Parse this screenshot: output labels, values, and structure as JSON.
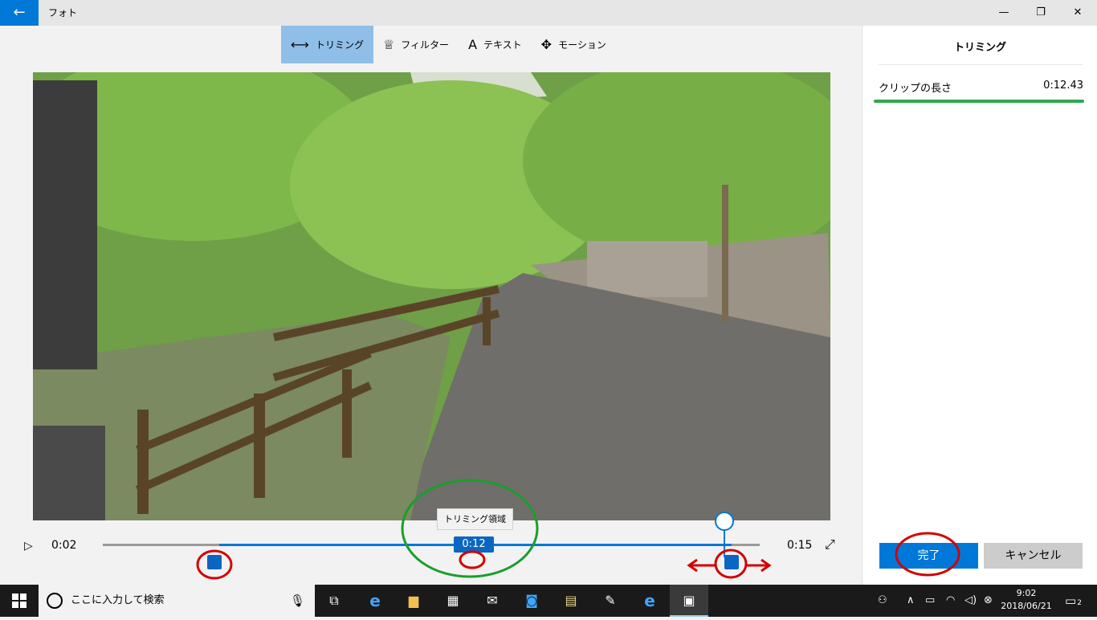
{
  "titlebar": {
    "back_icon": "←",
    "app_title": "フォト",
    "minimize": "—",
    "restore": "❐",
    "close": "✕"
  },
  "toolbar": {
    "items": [
      {
        "label": "トリミング",
        "icon": "trim-icon",
        "glyph": "⟷",
        "active": true
      },
      {
        "label": "フィルター",
        "icon": "filter-icon",
        "glyph": "♕",
        "active": false
      },
      {
        "label": "テキスト",
        "icon": "text-icon",
        "glyph": "A",
        "active": false
      },
      {
        "label": "モーション",
        "icon": "motion-icon",
        "glyph": "✥",
        "active": false
      }
    ]
  },
  "timeline": {
    "play_icon": "▷",
    "start_time": "0:02",
    "end_time": "0:15",
    "expand_icon": "⤢",
    "selection_duration": "0:12",
    "tooltip": "トリミング領域"
  },
  "panel": {
    "title": "トリミング",
    "clip_length_label": "クリップの長さ",
    "clip_length_value": "0:12.43",
    "done_label": "完了",
    "cancel_label": "キャンセル"
  },
  "taskbar": {
    "search_placeholder": "ここに入力して検索",
    "clock_time": "9:02",
    "clock_date": "2018/06/21",
    "notification_count": "2"
  },
  "colors": {
    "accent": "#0078d7",
    "annotation_red": "#d40000",
    "annotation_green": "#1a9e2a"
  }
}
